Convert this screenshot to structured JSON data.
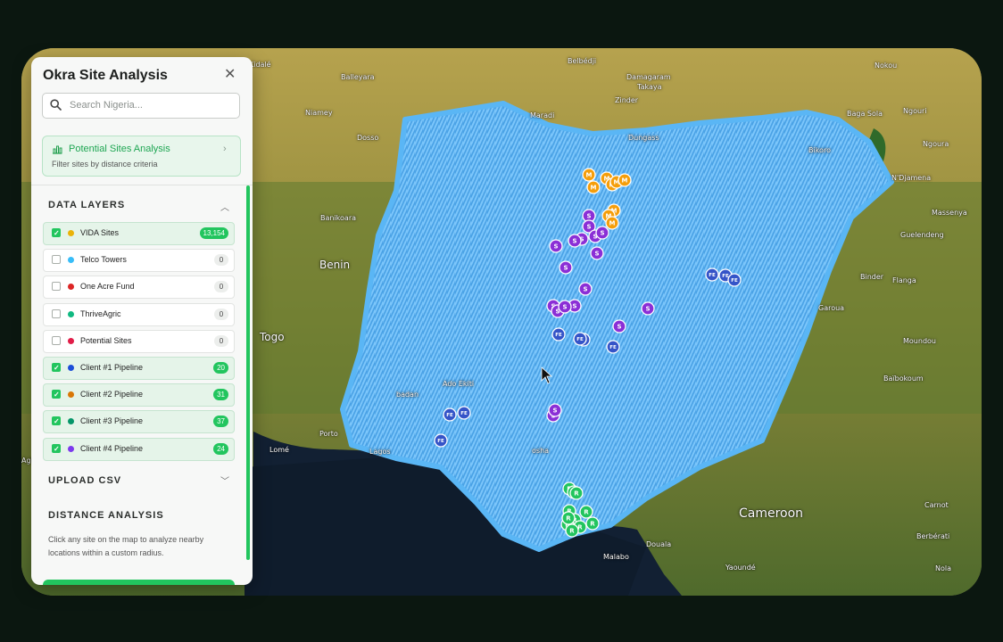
{
  "panel": {
    "title": "Okra Site Analysis",
    "search_placeholder": "Search Nigeria...",
    "potential_sites": {
      "title": "Potential Sites Analysis",
      "subtitle": "Filter sites by distance criteria"
    },
    "data_layers_title": "DATA LAYERS",
    "layers": [
      {
        "name": "VIDA Sites",
        "count": "13,154",
        "checked": true,
        "color": "#eab308"
      },
      {
        "name": "Telco Towers",
        "count": "0",
        "checked": false,
        "color": "#38bdf8"
      },
      {
        "name": "One Acre Fund",
        "count": "0",
        "checked": false,
        "color": "#dc2626"
      },
      {
        "name": "ThriveAgric",
        "count": "0",
        "checked": false,
        "color": "#10b981"
      },
      {
        "name": "Potential Sites",
        "count": "0",
        "checked": false,
        "color": "#e11d48"
      },
      {
        "name": "Client #1 Pipeline",
        "count": "20",
        "checked": true,
        "color": "#1d4ed8"
      },
      {
        "name": "Client #2 Pipeline",
        "count": "31",
        "checked": true,
        "color": "#d97706"
      },
      {
        "name": "Client #3 Pipeline",
        "count": "37",
        "checked": true,
        "color": "#059669"
      },
      {
        "name": "Client #4 Pipeline",
        "count": "24",
        "checked": true,
        "color": "#7c3aed"
      }
    ],
    "upload_csv_title": "UPLOAD CSV",
    "distance_title": "DISTANCE ANALYSIS",
    "distance_text": "Click any site on the map to analyze nearby locations within a custom radius."
  },
  "map": {
    "labels": {
      "kidal": "Kidalé",
      "belbedji": "Belbédji",
      "nokou": "Nokou",
      "damagaram": "Damagaram",
      "takaya": "Takaya",
      "balleyara": "Balleyara",
      "niamey": "Niamey",
      "maradi": "Maradi",
      "zinder": "Zinder",
      "baga_sola": "Baga Sola",
      "ngouri": "Ngouri",
      "dosso": "Dosso",
      "dungass": "Dungass",
      "ngoura": "Ngoura",
      "bikoro": "Bikoro",
      "djamena": "N'Djamena",
      "banikoara": "Banikoara",
      "massenya": "Massenya",
      "benin": "Benin",
      "guelendeng": "Guelendeng",
      "binder": "Binder",
      "flanga": "Flanga",
      "garoua": "Garoua",
      "togo": "Togo",
      "moundou": "Moundou",
      "ado_ekiti": "Ado Ekiti",
      "badan": "badan",
      "baibokoum": "Baïbokoum",
      "porto": "Porto",
      "lome": "Lomé",
      "lagos": "Lagos",
      "osha": "osha",
      "cameroon": "Cameroon",
      "carnot": "Carnot",
      "douala": "Douala",
      "malabo": "Malabo",
      "berberati": "Berbérati",
      "yaounde": "Yaoundé",
      "nola": "Nola",
      "agb": "Agb"
    },
    "markers": {
      "pipeline_2": "M",
      "pipeline_4": "S",
      "pipeline_1": "FE",
      "pipeline_3": "R"
    },
    "colors": {
      "heat": "#55b3f1",
      "pipeline_2": "#f59e0b",
      "pipeline_4": "#8b2fd6",
      "pipeline_1": "#3554c8",
      "pipeline_3": "#22c55e"
    }
  }
}
